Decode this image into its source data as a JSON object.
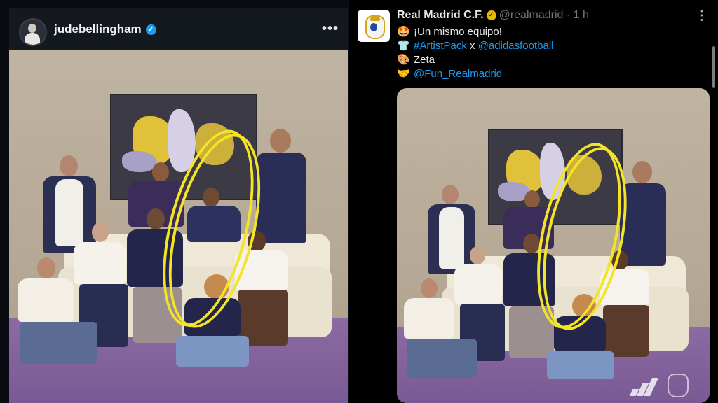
{
  "left_post": {
    "username": "judebellingham",
    "verified_icon": "verified-badge-icon",
    "more_icon": "more-options-icon",
    "more_label": "•••"
  },
  "right_post": {
    "display_name": "Real Madrid C.F.",
    "handle": "@realmadrid",
    "separator": "·",
    "time": "1 h",
    "more_label": "⋮",
    "lines": [
      {
        "emoji": "🤩",
        "icon": "star-struck-emoji-icon",
        "parts": [
          {
            "text": "¡Un mismo equipo!",
            "link": false
          }
        ]
      },
      {
        "emoji": "👕",
        "icon": "t-shirt-emoji-icon",
        "parts": [
          {
            "text": "#ArtistPack",
            "link": true
          },
          {
            "text": " x ",
            "link": false
          },
          {
            "text": "@adidasfootball",
            "link": true
          }
        ]
      },
      {
        "emoji": "🎨",
        "icon": "palette-emoji-icon",
        "parts": [
          {
            "text": "Zeta",
            "link": false
          }
        ]
      },
      {
        "emoji": "🤝",
        "icon": "handshake-emoji-icon",
        "parts": [
          {
            "text": "@Fun_Realmadrid",
            "link": true
          }
        ]
      }
    ]
  },
  "colors": {
    "link": "#1d9bf0",
    "highlight": "#f3e526",
    "floor": "#8c6aa3",
    "wall": "#bfb3a2"
  }
}
